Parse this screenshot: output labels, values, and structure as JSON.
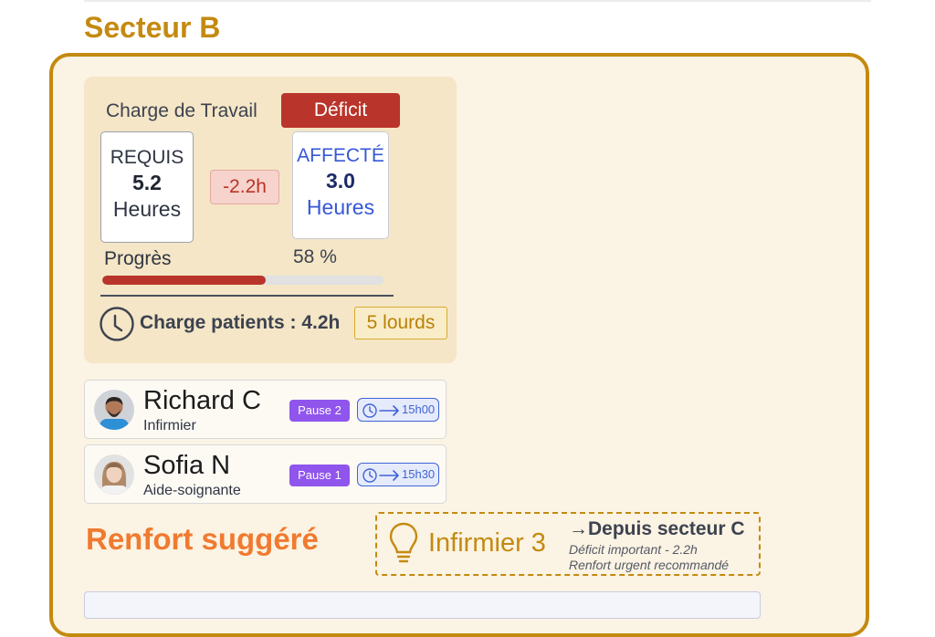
{
  "sector": {
    "title": "Secteur B"
  },
  "workload": {
    "label": "Charge de Travail",
    "status": "Déficit",
    "required": {
      "label": "REQUIS",
      "value": "5.2",
      "unit": "Heures"
    },
    "delta": "-2.2h",
    "assigned": {
      "label": "AFFECTÉ",
      "value": "3.0",
      "unit": "Heures"
    },
    "progress": {
      "label": "Progrès",
      "value_text": "58 %",
      "fraction": 0.58
    },
    "patients": {
      "text": "Charge patients : 4.2h",
      "heavy_badge": "5 lourds",
      "icon": "clock-icon"
    }
  },
  "staff": [
    {
      "name": "Richard C",
      "role": "Infirmier",
      "pause": "Pause 2",
      "end_time": "15h00"
    },
    {
      "name": "Sofia N",
      "role": "Aide-soignante",
      "pause": "Pause 1",
      "end_time": "15h30"
    }
  ],
  "reinforcement": {
    "title": "Renfort suggéré",
    "role": "Infirmier 3",
    "source": "Depuis secteur C",
    "note1": "Déficit important - 2.2h",
    "note2": "Renfort urgent recommandé",
    "icon": "lightbulb-icon"
  },
  "colors": {
    "accent": "#c48a10",
    "deficit": "#b9342a",
    "assigned": "#3657d6",
    "pause": "#8f55ec",
    "reinforce": "#f07a30"
  }
}
